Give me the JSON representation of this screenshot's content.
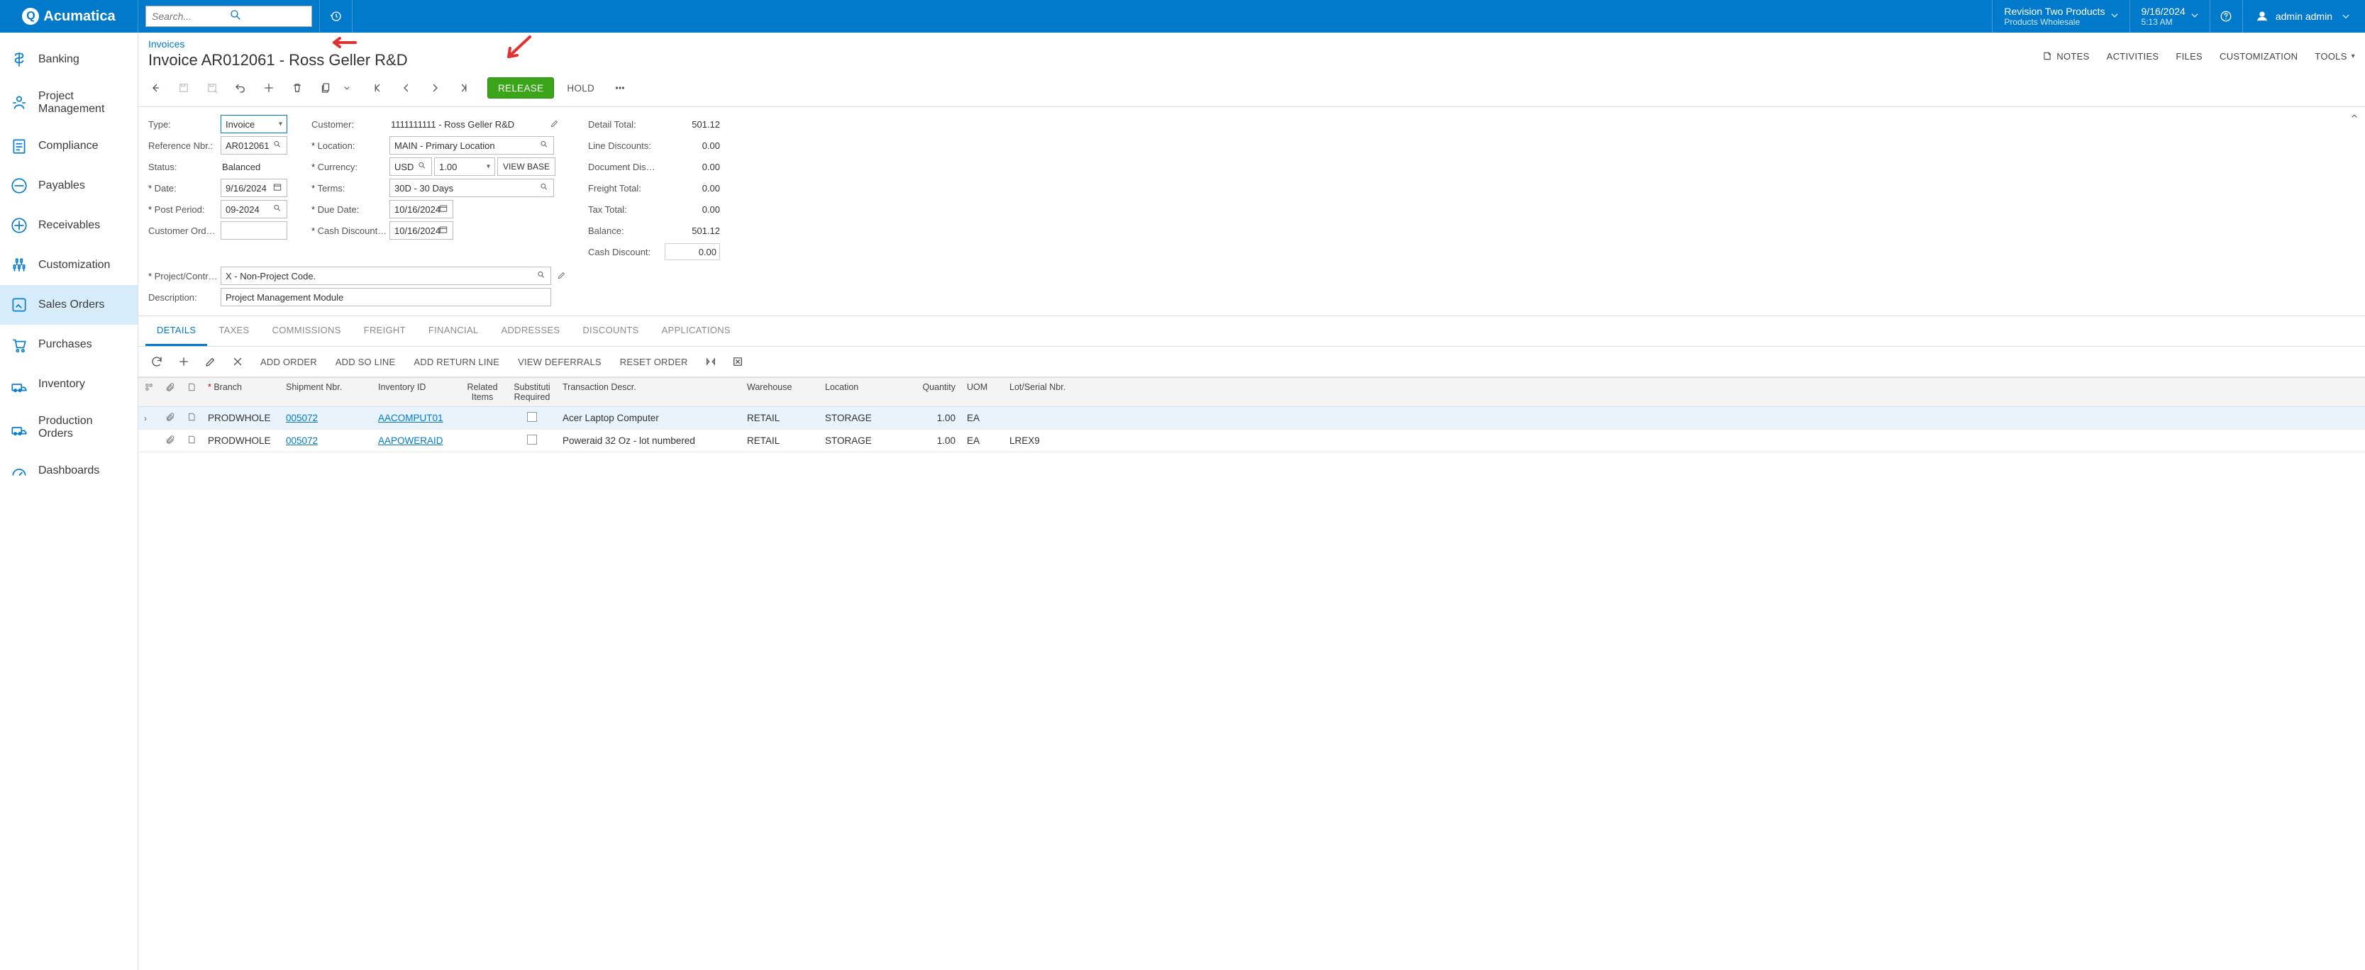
{
  "topbar": {
    "logo_text": "Acumatica",
    "search_placeholder": "Search...",
    "tenant": {
      "line1": "Revision Two Products",
      "line2": "Products Wholesale"
    },
    "datetime": {
      "line1": "9/16/2024",
      "line2": "5:13 AM"
    },
    "user": "admin admin"
  },
  "sidebar": {
    "items": [
      {
        "label": "Banking"
      },
      {
        "label": "Project Management"
      },
      {
        "label": "Compliance"
      },
      {
        "label": "Payables"
      },
      {
        "label": "Receivables"
      },
      {
        "label": "Customization"
      },
      {
        "label": "Sales Orders"
      },
      {
        "label": "Purchases"
      },
      {
        "label": "Inventory"
      },
      {
        "label": "Production Orders"
      },
      {
        "label": "Dashboards"
      }
    ]
  },
  "header": {
    "breadcrumb": "Invoices",
    "title": "Invoice AR012061 - Ross Geller R&D",
    "links": {
      "notes": "NOTES",
      "activities": "ACTIVITIES",
      "files": "FILES",
      "customization": "CUSTOMIZATION",
      "tools": "TOOLS"
    }
  },
  "toolbar": {
    "release": "RELEASE",
    "hold": "HOLD"
  },
  "form": {
    "labels": {
      "type": "Type:",
      "ref": "Reference Nbr.:",
      "status": "Status:",
      "date": "Date:",
      "post": "Post Period:",
      "custord": "Customer Ord…",
      "project": "Project/Contract:",
      "desc": "Description:",
      "customer": "Customer:",
      "location": "Location:",
      "currency": "Currency:",
      "terms": "Terms:",
      "duedate": "Due Date:",
      "cashdisc": "Cash Discount…",
      "viewbase": "VIEW BASE",
      "detailtotal": "Detail Total:",
      "linedisc": "Line Discounts:",
      "docdisc": "Document Dis…",
      "freight": "Freight Total:",
      "taxtotal": "Tax Total:",
      "balance": "Balance:",
      "cashdiscount": "Cash Discount:"
    },
    "values": {
      "type": "Invoice",
      "ref": "AR012061",
      "status": "Balanced",
      "date": "9/16/2024",
      "post": "09-2024",
      "custord": "",
      "project": "X - Non-Project Code.",
      "desc": "Project Management Module",
      "customer": "1111111111 - Ross Geller R&D",
      "location": "MAIN - Primary Location",
      "currency": "USD",
      "rate": "1.00",
      "terms": "30D - 30 Days",
      "duedate": "10/16/2024",
      "cashdiscdate": "10/16/2024",
      "detailtotal": "501.12",
      "linedisc": "0.00",
      "docdisc": "0.00",
      "freight": "0.00",
      "taxtotal": "0.00",
      "balance": "501.12",
      "cashdiscount": "0.00"
    }
  },
  "tabs": {
    "items": [
      "DETAILS",
      "TAXES",
      "COMMISSIONS",
      "FREIGHT",
      "FINANCIAL",
      "ADDRESSES",
      "DISCOUNTS",
      "APPLICATIONS"
    ]
  },
  "gridtoolbar": {
    "add_order": "ADD ORDER",
    "add_so_line": "ADD SO LINE",
    "add_return_line": "ADD RETURN LINE",
    "view_deferrals": "VIEW DEFERRALS",
    "reset_order": "RESET ORDER"
  },
  "grid": {
    "cols": {
      "branch": "Branch",
      "shipment": "Shipment Nbr.",
      "inventory": "Inventory ID",
      "related": "Related Items",
      "subst": "Substituti Required",
      "txdesc": "Transaction Descr.",
      "wh": "Warehouse",
      "loc": "Location",
      "qty": "Quantity",
      "uom": "UOM",
      "lot": "Lot/Serial Nbr."
    },
    "rows": [
      {
        "branch": "PRODWHOLE",
        "ship": "005072",
        "inv": "AACOMPUT01",
        "desc": "Acer Laptop Computer",
        "wh": "RETAIL",
        "loc": "STORAGE",
        "qty": "1.00",
        "uom": "EA",
        "lot": ""
      },
      {
        "branch": "PRODWHOLE",
        "ship": "005072",
        "inv": "AAPOWERAID",
        "desc": "Poweraid 32 Oz - lot numbered",
        "wh": "RETAIL",
        "loc": "STORAGE",
        "qty": "1.00",
        "uom": "EA",
        "lot": "LREX9"
      }
    ]
  }
}
